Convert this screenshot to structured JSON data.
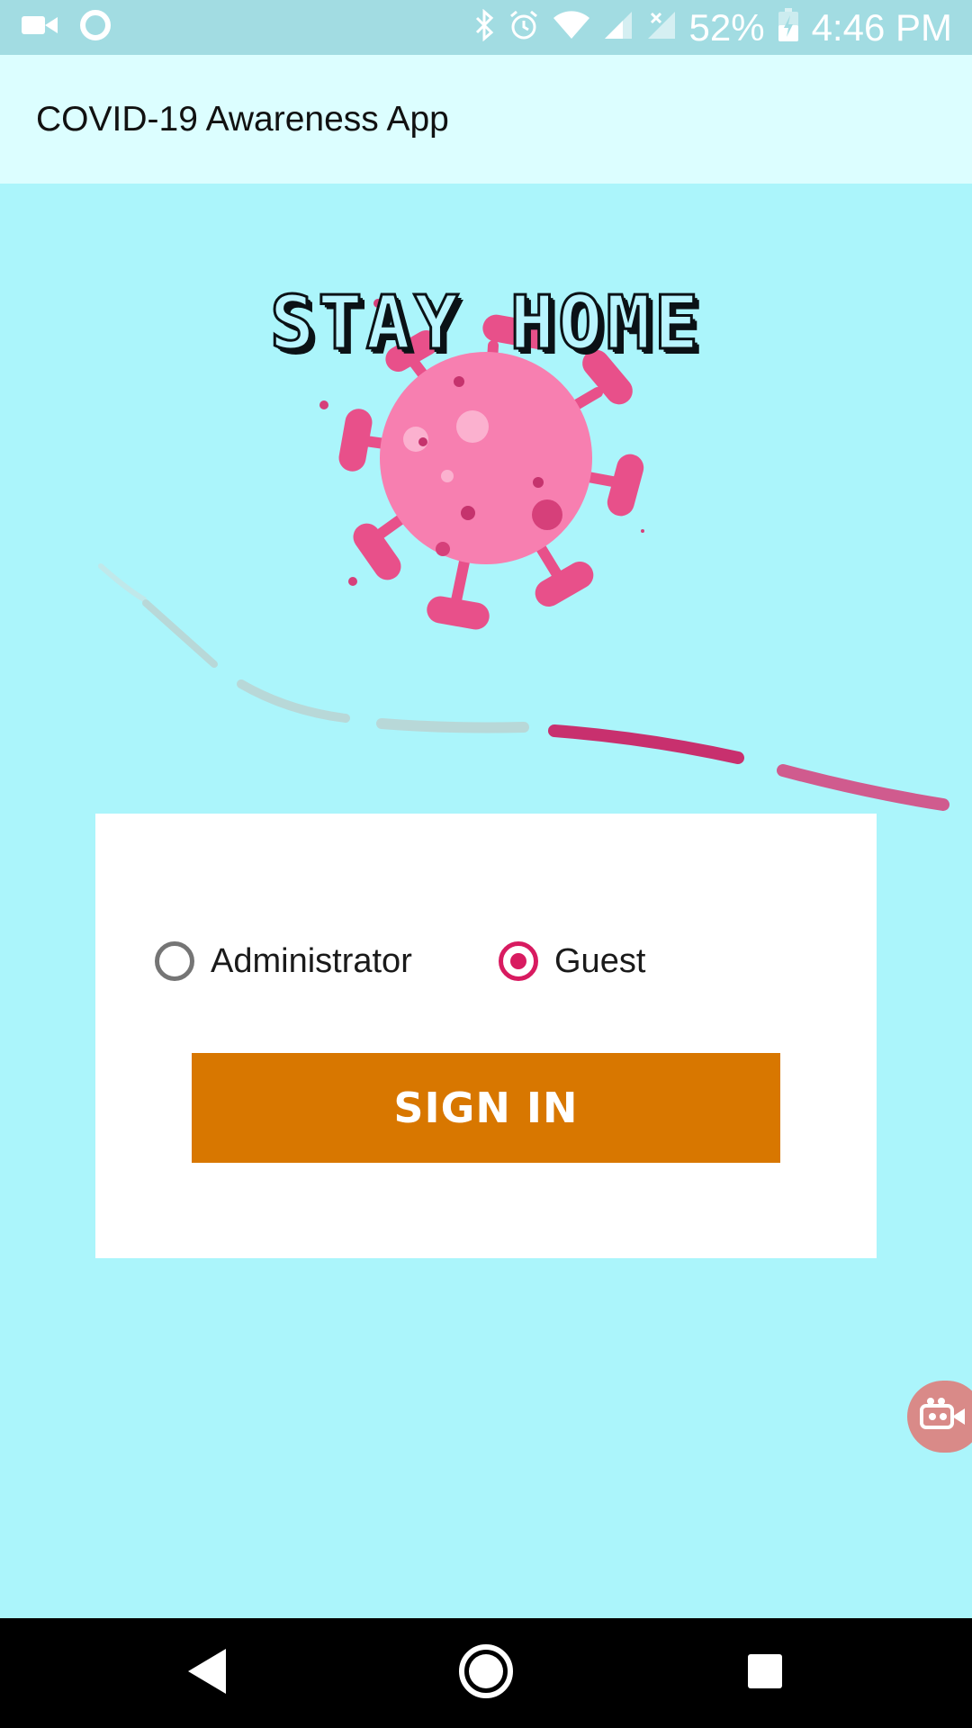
{
  "status_bar": {
    "battery": "52%",
    "time": "4:46 PM",
    "icons": [
      "video-camera-icon",
      "circle-notification-icon",
      "bluetooth-icon",
      "alarm-icon",
      "wifi-icon",
      "signal-icon",
      "signal-no-sim-icon",
      "battery-icon"
    ]
  },
  "app_bar": {
    "title": "COVID-19 Awareness App"
  },
  "hero": {
    "banner_text": "STAY HOME",
    "illustration": "virus-illustration",
    "colors": {
      "virus": "#f77fb0",
      "virus_dark": "#d6407a",
      "trail_grey": "#b8d8d8",
      "trail_pink": "#c8306e"
    }
  },
  "login_card": {
    "role_options": [
      {
        "label": "Administrator",
        "checked": false
      },
      {
        "label": "Guest",
        "checked": true
      }
    ],
    "sign_in_label": "SIGN IN"
  },
  "colors": {
    "background": "#abf5fb",
    "app_bar": "#dcfeff",
    "status_bar": "#a2dce2",
    "accent": "#d81b60",
    "button": "#d87700"
  },
  "floating_button": {
    "icon": "screen-record-icon"
  },
  "nav_bar": {
    "buttons": [
      "back-icon",
      "home-icon",
      "recents-icon"
    ]
  }
}
